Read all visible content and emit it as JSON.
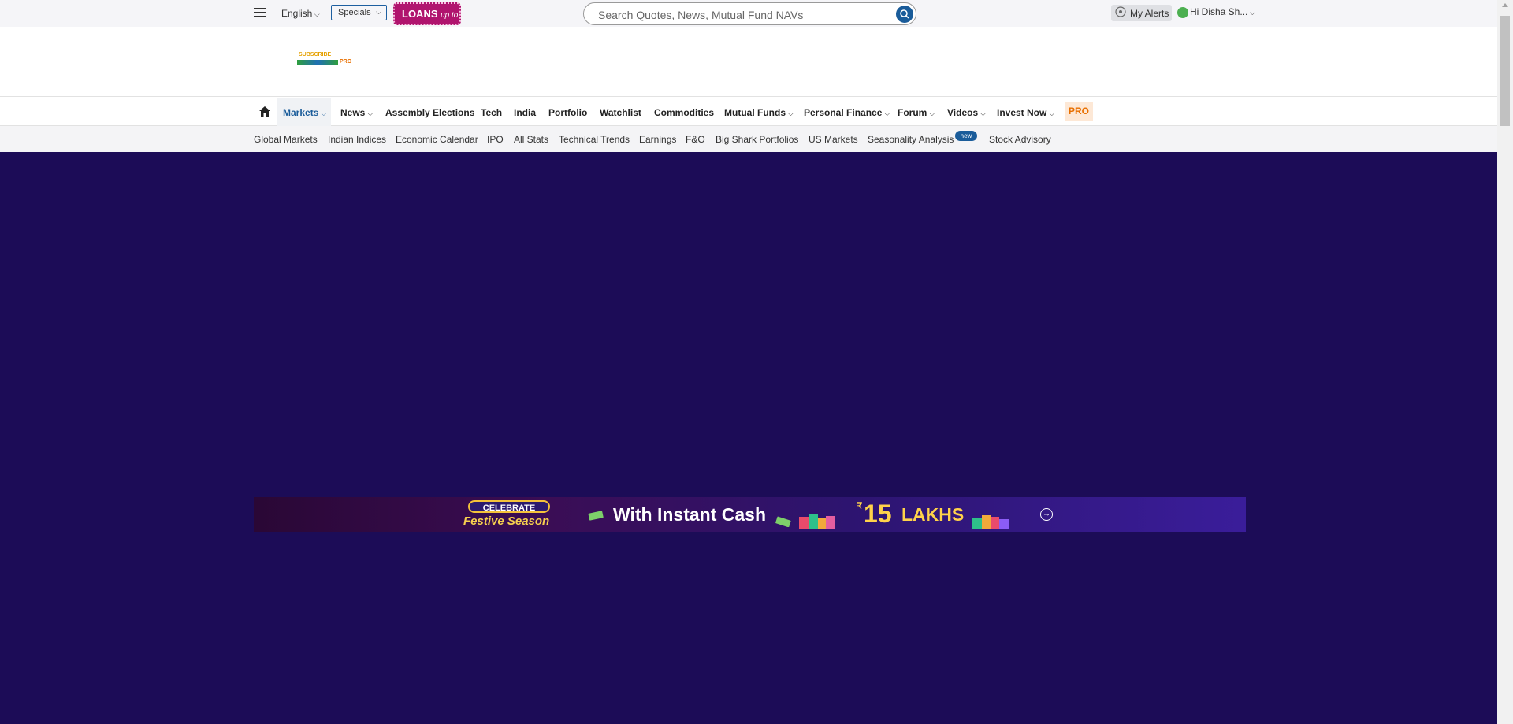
{
  "topbar": {
    "language": "English",
    "specials": "Specials",
    "loans": {
      "main": "LOANS",
      "sub": "up to"
    },
    "search_placeholder": "Search Quotes, News, Mutual Fund NAVs",
    "alerts": "My Alerts",
    "user": "Hi Disha Sh..."
  },
  "ad": {
    "logo_line1": "SUBSCRIBE",
    "logo_line3": "PRO"
  },
  "nav": {
    "items": [
      {
        "label": "Markets",
        "dropdown": true,
        "active": true
      },
      {
        "label": "News",
        "dropdown": true
      },
      {
        "label": "Assembly Elections"
      },
      {
        "label": "Tech"
      },
      {
        "label": "India"
      },
      {
        "label": "Portfolio"
      },
      {
        "label": "Watchlist"
      },
      {
        "label": "Commodities"
      },
      {
        "label": "Mutual Funds",
        "dropdown": true
      },
      {
        "label": "Personal Finance",
        "dropdown": true
      },
      {
        "label": "Forum",
        "dropdown": true
      },
      {
        "label": "Videos",
        "dropdown": true
      },
      {
        "label": "Invest Now",
        "dropdown": true
      }
    ],
    "pro": "PRO"
  },
  "subnav": {
    "items": [
      "Global Markets",
      "Indian Indices",
      "Economic Calendar",
      "IPO",
      "All Stats",
      "Technical Trends",
      "Earnings",
      "F&O",
      "Big Shark Portfolios",
      "US Markets",
      "Seasonality Analysis",
      "Stock Advisory"
    ],
    "badge": "new"
  },
  "banner": {
    "celebrate": "CELEBRATE",
    "festive": "Festive Season",
    "instant": "With Instant Cash",
    "rupee": "₹",
    "amount": "15",
    "lakhs": "LAKHS"
  },
  "colors": {
    "page_bg": "#1c0c57",
    "accent": "#1a5c9a",
    "loans_bg": "#b0146e",
    "pro": "#e86f00"
  }
}
